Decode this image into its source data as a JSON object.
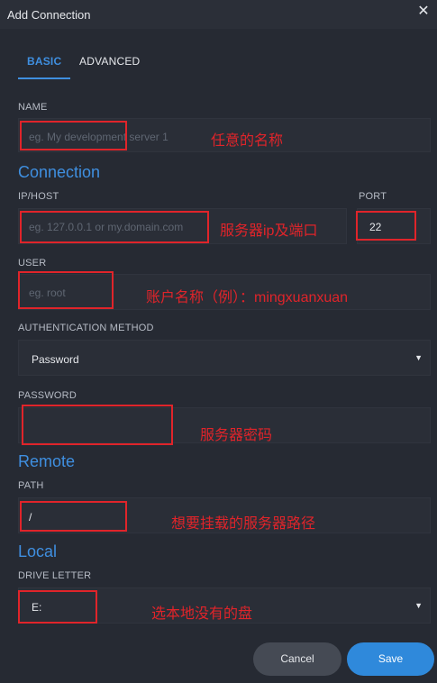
{
  "window": {
    "title": "Add Connection",
    "close_icon": "close-icon"
  },
  "tabs": [
    {
      "label": "BASIC",
      "active": true
    },
    {
      "label": "ADVANCED",
      "active": false
    }
  ],
  "fields": {
    "name": {
      "label": "NAME",
      "placeholder": "eg. My development server 1",
      "value": ""
    },
    "connection_section": "Connection",
    "host": {
      "label": "IP/HOST",
      "placeholder": "eg. 127.0.0.1 or my.domain.com",
      "value": ""
    },
    "port": {
      "label": "PORT",
      "value": "22"
    },
    "user": {
      "label": "USER",
      "placeholder": "eg. root",
      "value": ""
    },
    "auth_method": {
      "label": "AUTHENTICATION METHOD",
      "value": "Password",
      "icon": "dropdown-triangle-icon"
    },
    "password": {
      "label": "PASSWORD",
      "value": ""
    },
    "remote_section": "Remote",
    "path": {
      "label": "PATH",
      "value": "/"
    },
    "local_section": "Local",
    "drive_letter": {
      "label": "DRIVE LETTER",
      "value": "E:",
      "icon": "dropdown-triangle-icon"
    }
  },
  "annotations": {
    "name": "任意的名称",
    "host": "服务器ip及端口",
    "user": "账户名称（例）：mingxuanxuan",
    "password": "服务器密码",
    "path": "想要挂载的服务器路径",
    "drive": "选本地没有的盘",
    "color": "#e0242a"
  },
  "buttons": {
    "cancel": "Cancel",
    "save": "Save"
  },
  "colors": {
    "accent": "#3f8fe0",
    "background": "#262a33",
    "save_button": "#2f89db"
  }
}
